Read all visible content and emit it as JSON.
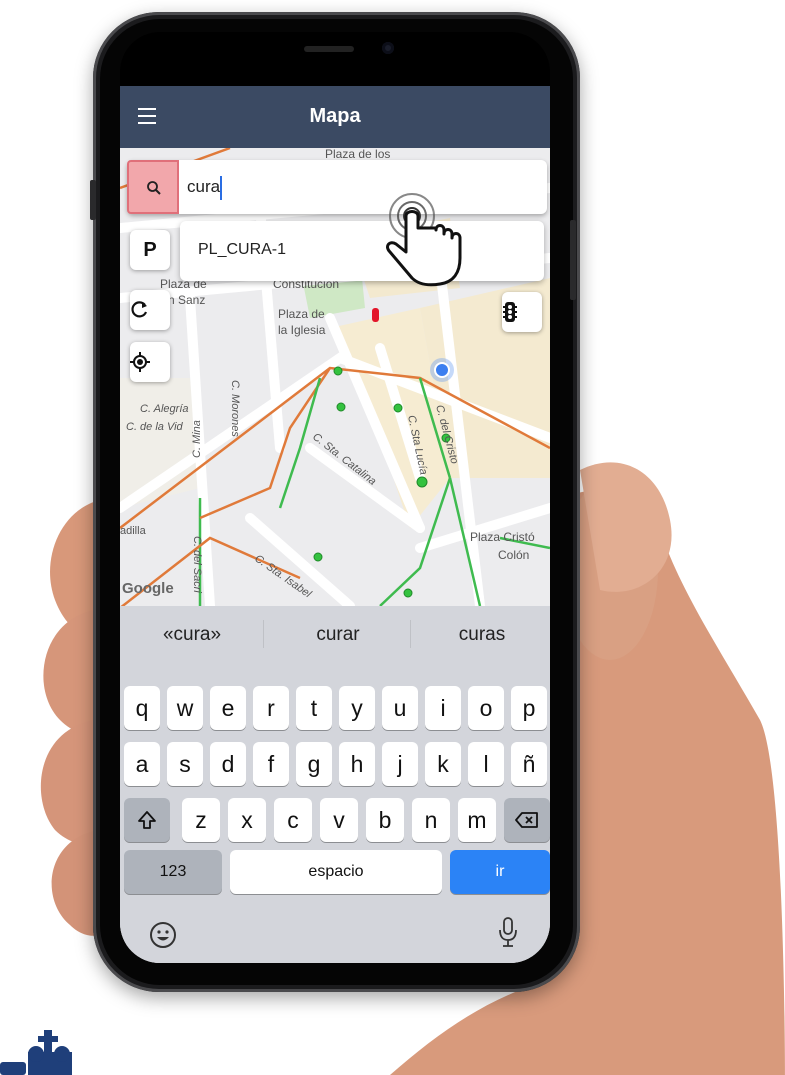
{
  "app": {
    "title": "Mapa"
  },
  "search": {
    "value": "cura"
  },
  "suggestions": [
    {
      "label": "PL_CURA-1"
    }
  ],
  "controls": {
    "parking_label": "P"
  },
  "map": {
    "labels": {
      "plaza_de_los": "Plaza de los",
      "constitucion": "Constitución",
      "plaza_de": "Plaza de",
      "san_sanz": "n Sanz",
      "plaza_iglesia_1": "Plaza de",
      "plaza_iglesia_2": "la Iglesia",
      "c_morones": "C. Morones",
      "c_alegria": "C. Alegría",
      "c_vid": "C. de la Vid",
      "c_mina": "C. Mina",
      "c_sta_catalina": "C. Sta. Catalina",
      "c_sta_lucia": "C. Sta Lucía",
      "c_cristo": "C. del Cristo",
      "c_sta_isabel": "C. Sta. Isabel",
      "c_sacri": "C. del Sacri",
      "plaza_colon_1": "Plaza Cristó",
      "plaza_colon_2": "Colón",
      "adilla": "adilla",
      "google": "Google"
    }
  },
  "keyboard": {
    "suggestions": [
      "«cura»",
      "curar",
      "curas"
    ],
    "rows": [
      [
        "q",
        "w",
        "e",
        "r",
        "t",
        "y",
        "u",
        "i",
        "o",
        "p"
      ],
      [
        "a",
        "s",
        "d",
        "f",
        "g",
        "h",
        "j",
        "k",
        "l",
        "ñ"
      ],
      [
        "z",
        "x",
        "c",
        "v",
        "b",
        "n",
        "m"
      ]
    ],
    "numbers_label": "123",
    "space_label": "espacio",
    "go_label": "ir"
  },
  "colors": {
    "appbar": "#3b4a63",
    "search_button": "#f2a7ab",
    "go_key": "#2b83f6"
  }
}
